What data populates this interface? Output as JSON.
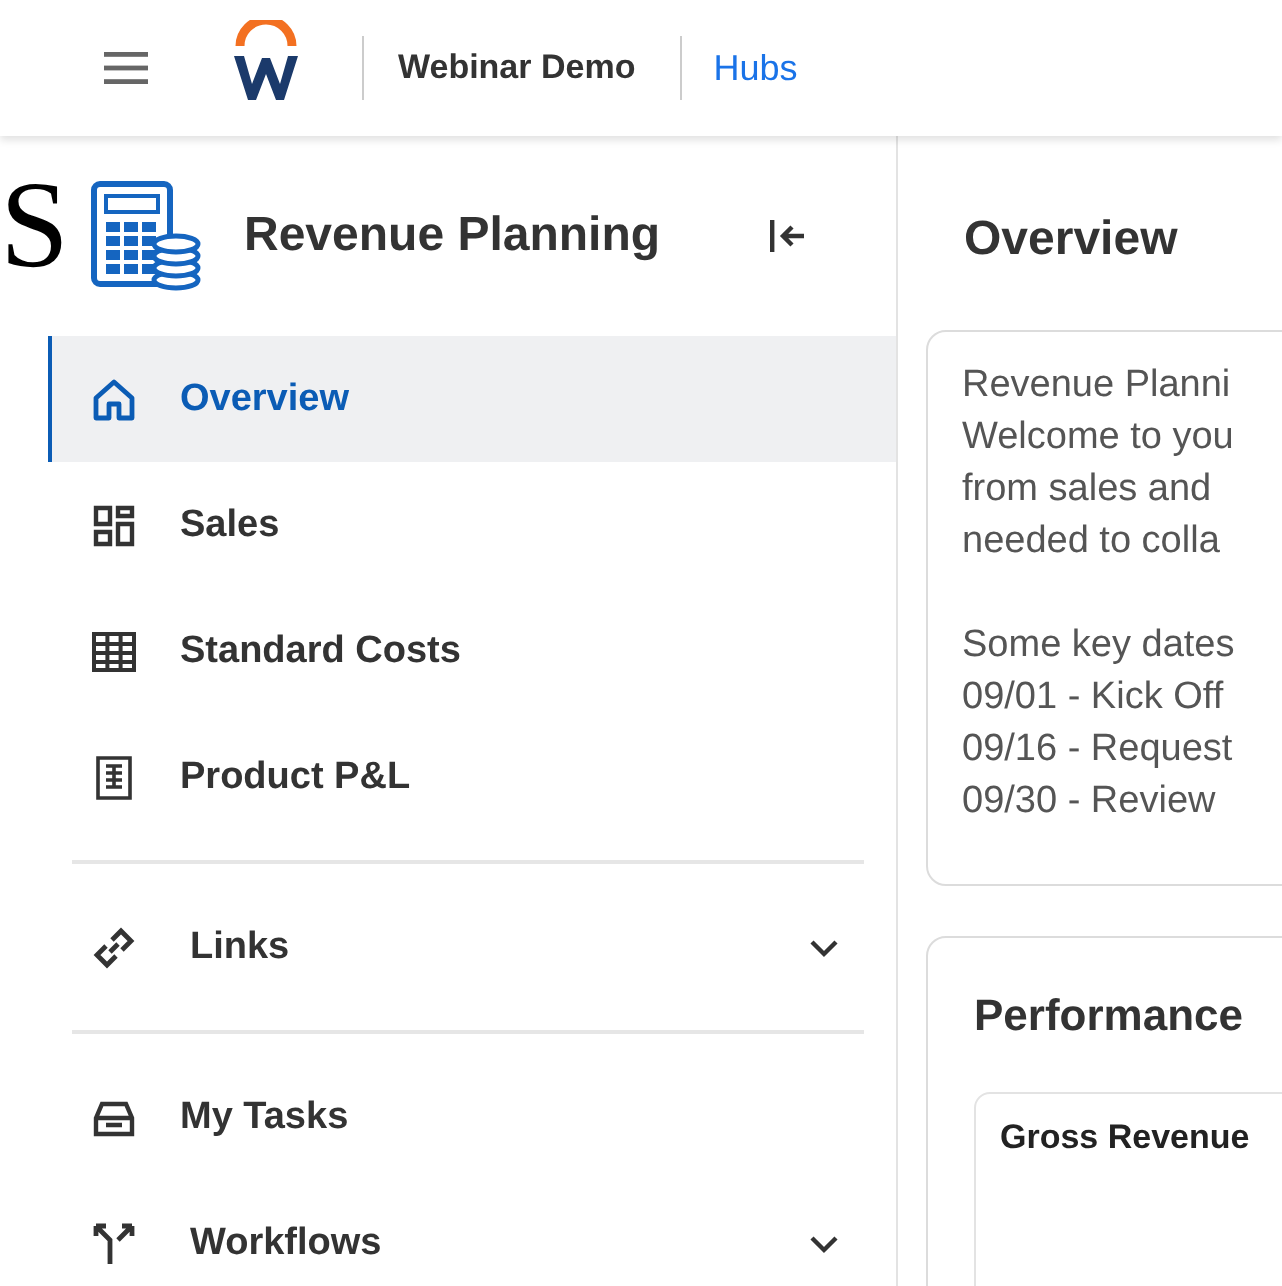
{
  "header": {
    "title": "Webinar Demo",
    "link": "Hubs"
  },
  "stray_letter": "S",
  "sidebar": {
    "title": "Revenue Planning",
    "items": [
      {
        "kind": "page",
        "label": "Overview",
        "selected": true
      },
      {
        "kind": "page",
        "label": "Sales",
        "selected": false
      },
      {
        "kind": "page",
        "label": "Standard Costs",
        "selected": false
      },
      {
        "kind": "page",
        "label": "Product P&L",
        "selected": false
      },
      {
        "kind": "divider"
      },
      {
        "kind": "section",
        "label": "Links",
        "expanded": false
      },
      {
        "kind": "divider"
      },
      {
        "kind": "page",
        "label": "My Tasks",
        "selected": false
      },
      {
        "kind": "section",
        "label": "Workflows",
        "expanded": false
      }
    ]
  },
  "main": {
    "title": "Overview",
    "intro_lines": [
      "Revenue Planni",
      "Welcome to you",
      "from sales and",
      "needed to colla"
    ],
    "date_lines": [
      "Some key dates",
      "09/01 - Kick Off",
      "09/16 - Request",
      "09/30 - Review"
    ],
    "performance": {
      "title": "Performance",
      "cards": [
        {
          "title": "Gross Revenue"
        }
      ]
    }
  }
}
